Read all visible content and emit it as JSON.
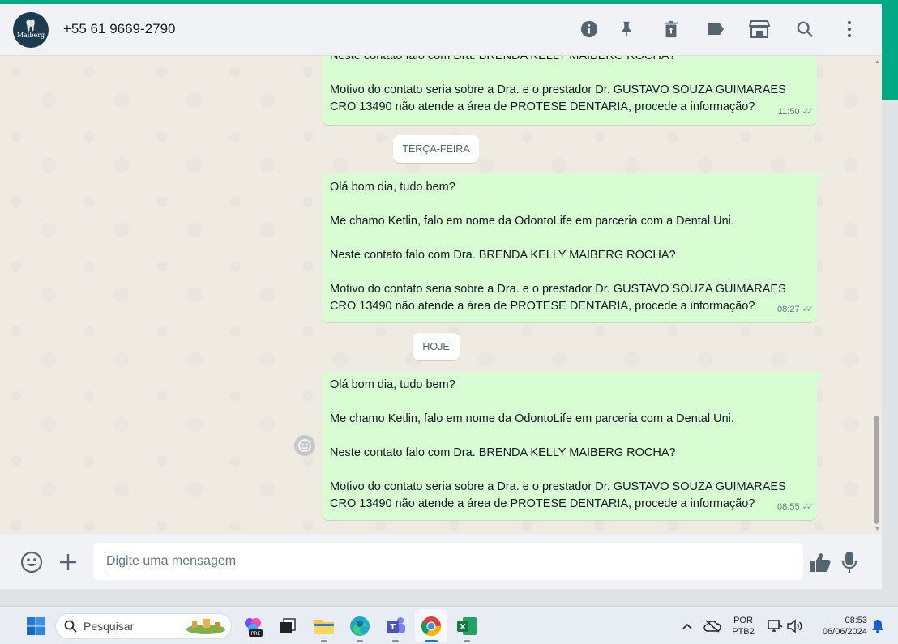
{
  "header": {
    "avatar_text": "Maiberg",
    "contact": "+55 61 9669-2790"
  },
  "messages": [
    {
      "paragraphs": [
        "Neste contato falo com Dra. BRENDA KELLY MAIBERG ROCHA?",
        "Motivo do contato seria sobre a Dra. e o prestador Dr. GUSTAVO SOUZA GUIMARAES CRO 13490 não atende a área de PROTESE DENTARIA, procede a informação?"
      ],
      "time": "11:50"
    },
    {
      "paragraphs": [
        "Olá bom dia, tudo bem?",
        "Me chamo Ketlin, falo em nome da OdontoLife em parceria com a Dental Uni.",
        "Neste contato falo com Dra. BRENDA KELLY MAIBERG ROCHA?",
        "Motivo do contato seria sobre a Dra. e o prestador Dr. GUSTAVO SOUZA GUIMARAES CRO 13490 não atende a área de PROTESE DENTARIA, procede a informação?"
      ],
      "time": "08:27"
    },
    {
      "paragraphs": [
        "Olá bom dia, tudo bem?",
        "Me chamo Ketlin, falo em nome da OdontoLife em parceria com a Dental Uni.",
        "Neste contato falo com Dra. BRENDA KELLY MAIBERG ROCHA?",
        "Motivo do contato seria sobre a Dra. e o prestador Dr. GUSTAVO SOUZA GUIMARAES CRO 13490 não atende a área de PROTESE DENTARIA, procede a informação?"
      ],
      "time": "08:55"
    }
  ],
  "day_chips": [
    "TERÇA-FEIRA",
    "HOJE"
  ],
  "composer": {
    "placeholder": "Digite uma mensagem"
  },
  "taskbar": {
    "search_label": "Pesquisar",
    "copilot_badge": "PRE",
    "lang_line1": "POR",
    "lang_line2": "PTB2",
    "clock_time": "08:53",
    "clock_date": "06/06/2024"
  },
  "colors": {
    "accent": "#00a884",
    "outgoing_bubble": "#d9fdd3",
    "chat_bg": "#efeae2"
  }
}
